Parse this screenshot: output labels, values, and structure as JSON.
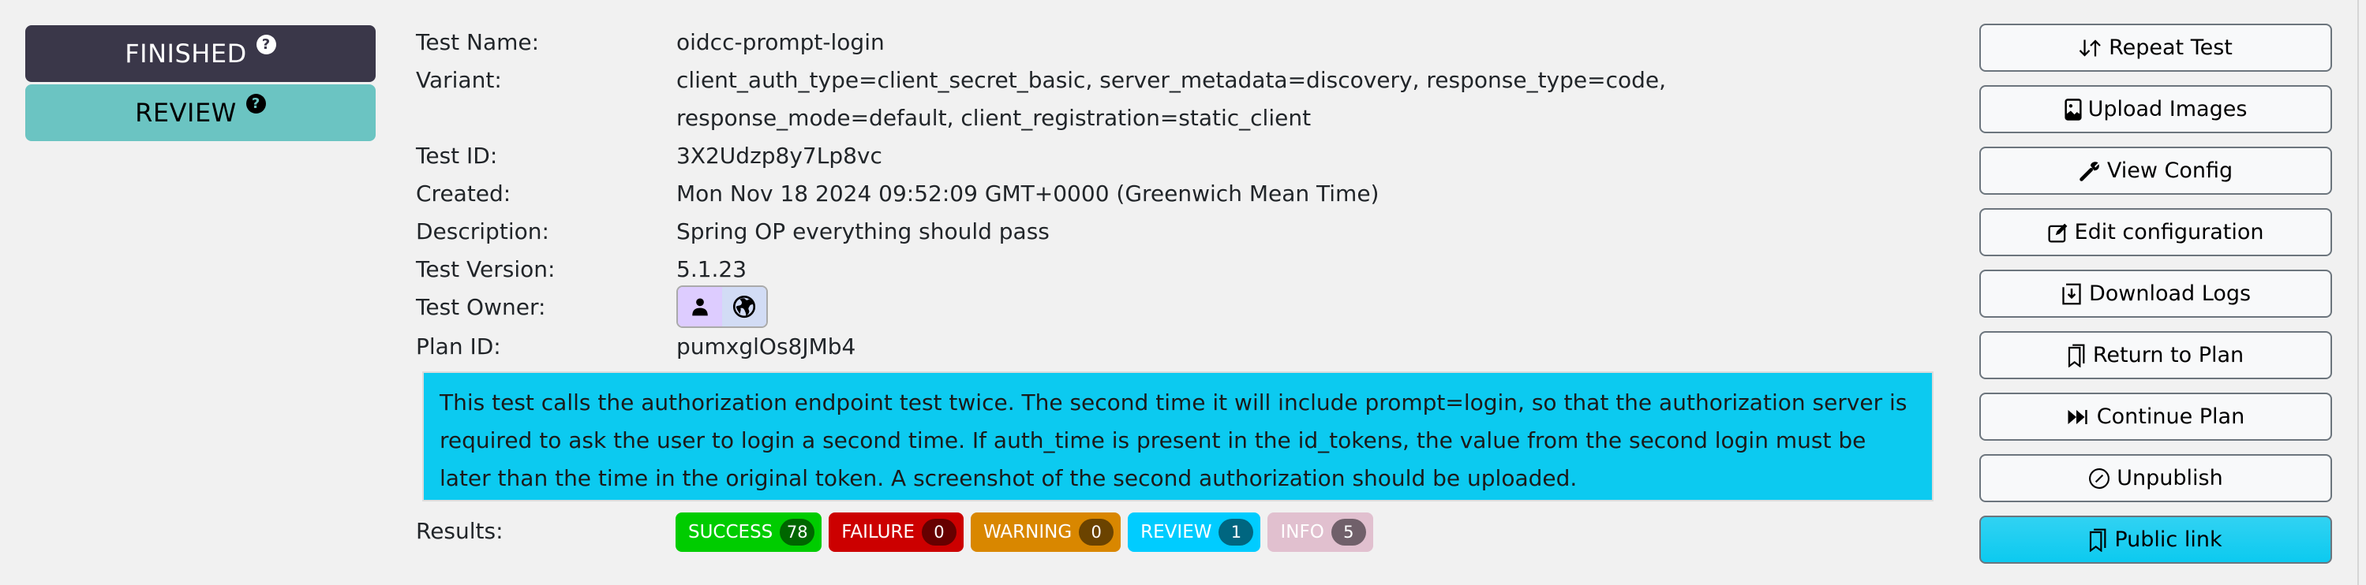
{
  "status": {
    "state_label": "FINISHED",
    "result_label": "REVIEW",
    "help_glyph": "?"
  },
  "info": {
    "rows": [
      {
        "label": "Test Name:",
        "value": "oidcc-prompt-login"
      },
      {
        "label": "Variant:",
        "value": "client_auth_type=client_secret_basic, server_metadata=discovery, response_type=code, response_mode=default, client_registration=static_client"
      },
      {
        "label": "Test ID:",
        "value": "3X2Udzp8y7Lp8vc"
      },
      {
        "label": "Created:",
        "value": "Mon Nov 18 2024 09:52:09 GMT+0000 (Greenwich Mean Time)"
      },
      {
        "label": "Description:",
        "value": "Spring OP everything should pass"
      },
      {
        "label": "Test Version:",
        "value": "5.1.23"
      },
      {
        "label": "Test Owner:",
        "value": ""
      },
      {
        "label": "Plan ID:",
        "value": "pumxglOs8JMb4"
      }
    ],
    "owner_icons": [
      "user-icon",
      "globe-icon"
    ]
  },
  "description_text": "This test calls the authorization endpoint test twice. The second time it will include prompt=login, so that the authorization server is required to ask the user to login a second time. If auth_time is present in the id_tokens, the value from the second login must be later than the time in the original token. A screenshot of the second authorization should be uploaded.",
  "results": {
    "label": "Results:",
    "badges": [
      {
        "label": "SUCCESS",
        "count": "78",
        "color": "#00cc00",
        "count_color": "#006600"
      },
      {
        "label": "FAILURE",
        "count": "0",
        "color": "#cc0000",
        "count_color": "#660000"
      },
      {
        "label": "WARNING",
        "count": "0",
        "color": "#d98700",
        "count_color": "#6b4300"
      },
      {
        "label": "REVIEW",
        "count": "1",
        "color": "#00ccff",
        "count_color": "#006680"
      },
      {
        "label": "INFO",
        "count": "5",
        "color": "#e1c0cf",
        "count_color": "#70606a"
      }
    ]
  },
  "actions": [
    {
      "label": "Repeat Test",
      "icon": "repeat-arrows-icon"
    },
    {
      "label": "Upload Images",
      "icon": "image-icon"
    },
    {
      "label": "View Config",
      "icon": "wrench-icon"
    },
    {
      "label": "Edit configuration",
      "icon": "edit-icon"
    },
    {
      "label": "Download Logs",
      "icon": "download-icon"
    },
    {
      "label": "Return to Plan",
      "icon": "bookmarks-icon"
    },
    {
      "label": "Continue Plan",
      "icon": "fast-forward-icon"
    },
    {
      "label": "Unpublish",
      "icon": "slash-circle-icon"
    },
    {
      "label": "Public link",
      "icon": "bookmarks-icon"
    }
  ]
}
